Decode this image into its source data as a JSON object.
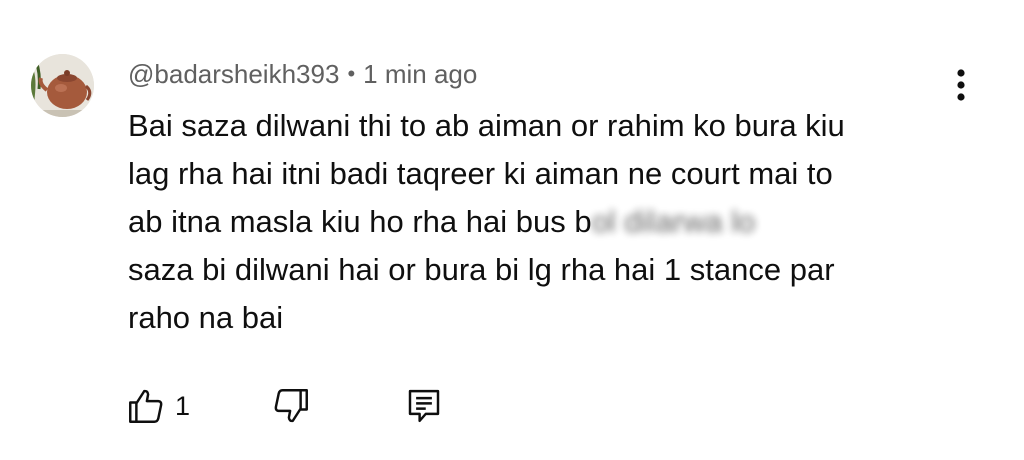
{
  "comment": {
    "author": "@badarsheikh393",
    "separator": "•",
    "time": "1 min ago",
    "lines": [
      "Bai saza dilwani thi to ab aiman or rahim ko bura kiu",
      "lag rha hai itni badi taqreer ki aiman ne court mai to",
      "saza bi dilwani hai or bura bi lg rha hai 1 stance par",
      "raho na bai"
    ],
    "line3_visible_start": "ab itna masla kiu ho rha hai bus b",
    "line3_visible_end": "arwa lo",
    "likes": "1"
  },
  "icons": {
    "avatar": "avatar",
    "more": "more-vert-icon",
    "like": "thumb-up-icon",
    "dislike": "thumb-down-icon",
    "reply": "reply-comment-icon"
  },
  "colors": {
    "text": "#0f0f0f",
    "meta": "#606060",
    "background": "#ffffff"
  }
}
